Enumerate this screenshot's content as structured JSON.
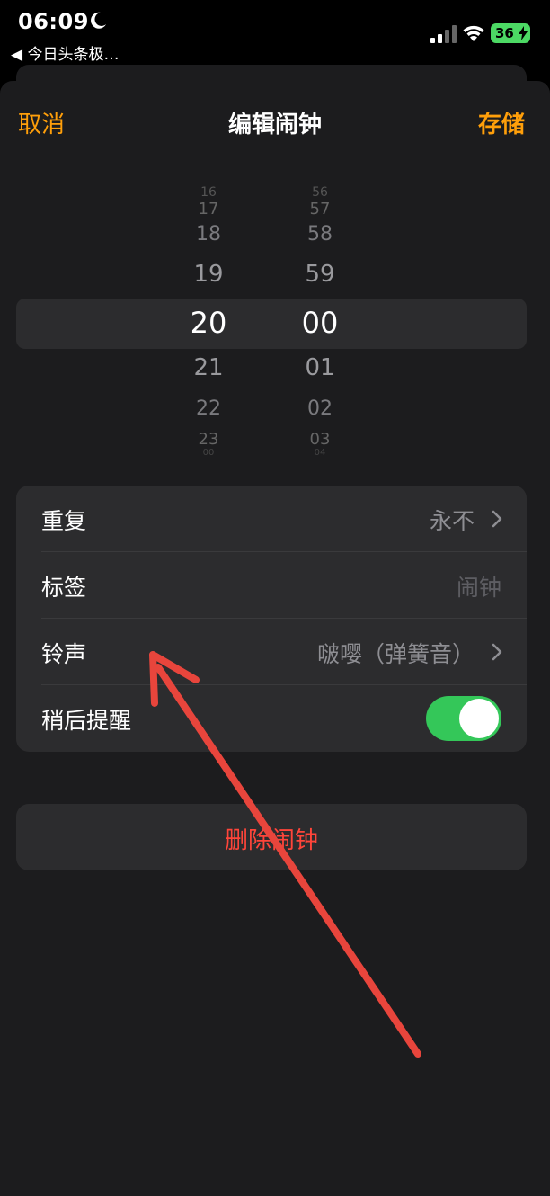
{
  "status_bar": {
    "time": "06:09",
    "back_app": "◀ 今日头条极…",
    "battery": "36",
    "icons": [
      "moon-icon",
      "signal-icon",
      "wifi-icon",
      "battery-icon"
    ]
  },
  "nav": {
    "cancel": "取消",
    "title": "编辑闹钟",
    "save": "存储"
  },
  "picker": {
    "hours": [
      "16",
      "17",
      "18",
      "19",
      "20",
      "21",
      "22",
      "23",
      "00"
    ],
    "minutes": [
      "56",
      "57",
      "58",
      "59",
      "00",
      "01",
      "02",
      "03",
      "04"
    ],
    "selected_hour": "20",
    "selected_minute": "00"
  },
  "settings": {
    "repeat": {
      "label": "重复",
      "value": "永不"
    },
    "label_row": {
      "label": "标签",
      "value": "闹钟"
    },
    "sound": {
      "label": "铃声",
      "value": "啵嘤（弹簧音）"
    },
    "snooze": {
      "label": "稍后提醒",
      "on": true
    }
  },
  "delete": {
    "label": "删除闹钟"
  },
  "colors": {
    "accent": "#ff9f0a",
    "destructive": "#ff453a",
    "toggle_on": "#34c759",
    "annotation_arrow": "#e8453c"
  }
}
